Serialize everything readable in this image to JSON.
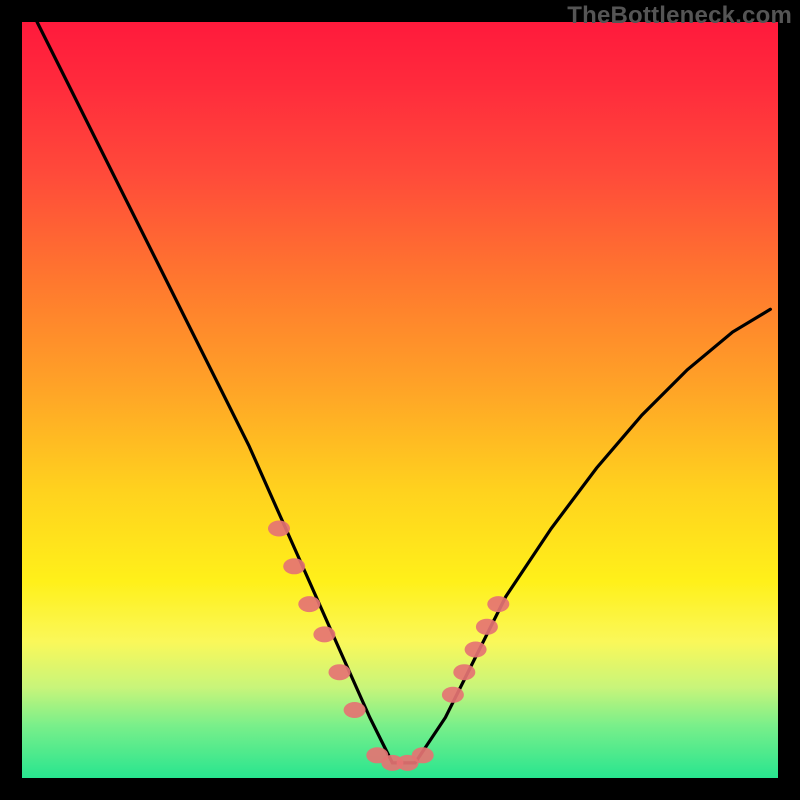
{
  "watermark": "TheBottleneck.com",
  "colors": {
    "gradient_top": "#ff1a3c",
    "gradient_mid1": "#ff7a2e",
    "gradient_mid2": "#ffd21e",
    "gradient_bottom": "#28e58f",
    "frame": "#000000",
    "curve": "#000000",
    "markers": "#e57373"
  },
  "chart_data": {
    "type": "line",
    "title": "",
    "xlabel": "",
    "ylabel": "",
    "xlim": [
      0,
      100
    ],
    "ylim": [
      0,
      100
    ],
    "grid": false,
    "legend": false,
    "series": [
      {
        "name": "bottleneck-curve",
        "x": [
          2,
          6,
          10,
          14,
          18,
          22,
          26,
          30,
          34,
          38,
          42,
          46,
          49,
          52,
          56,
          60,
          64,
          70,
          76,
          82,
          88,
          94,
          99
        ],
        "y": [
          100,
          92,
          84,
          76,
          68,
          60,
          52,
          44,
          35,
          26,
          17,
          8,
          2,
          2,
          8,
          16,
          24,
          33,
          41,
          48,
          54,
          59,
          62
        ]
      }
    ],
    "markers": [
      {
        "name": "left-arm-markers",
        "x": [
          34,
          36,
          38,
          40,
          42,
          44
        ],
        "y": [
          33,
          28,
          23,
          19,
          14,
          9
        ]
      },
      {
        "name": "valley-markers",
        "x": [
          47,
          49,
          51,
          53
        ],
        "y": [
          3,
          2,
          2,
          3
        ]
      },
      {
        "name": "right-arm-markers",
        "x": [
          57,
          58.5,
          60,
          61.5,
          63
        ],
        "y": [
          11,
          14,
          17,
          20,
          23
        ]
      }
    ]
  }
}
